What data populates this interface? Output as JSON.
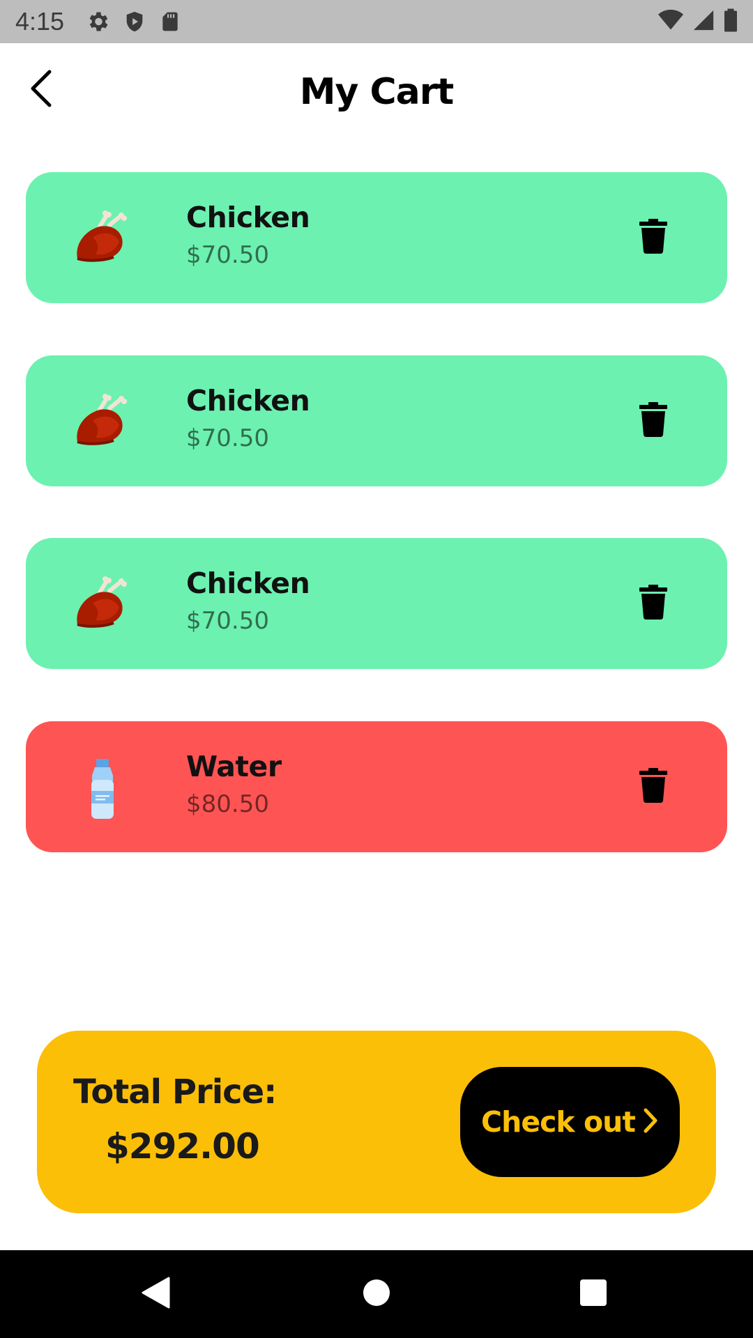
{
  "status_bar": {
    "time": "4:15",
    "icons": [
      "gear-icon",
      "shield-icon",
      "sd-card-icon",
      "wifi-icon",
      "cell-signal-icon",
      "battery-icon"
    ]
  },
  "header": {
    "title": "My Cart",
    "back_icon": "chevron-left-icon"
  },
  "cart": {
    "items": [
      {
        "name": "Chicken",
        "price": "$70.50",
        "icon": "roast-chicken-icon",
        "color": "#6cf1b0"
      },
      {
        "name": "Chicken",
        "price": "$70.50",
        "icon": "roast-chicken-icon",
        "color": "#6cf1b0"
      },
      {
        "name": "Chicken",
        "price": "$70.50",
        "icon": "roast-chicken-icon",
        "color": "#6cf1b0"
      },
      {
        "name": "Water",
        "price": "$80.50",
        "icon": "water-bottle-icon",
        "color": "#ff5454"
      }
    ],
    "delete_icon": "trash-icon"
  },
  "summary": {
    "total_label": "Total Price:",
    "total_value": "$292.00",
    "checkout_label": "Check out",
    "panel_color": "#fcbf07"
  },
  "nav_bar": {
    "buttons": [
      "back-triangle-icon",
      "home-circle-icon",
      "recents-square-icon"
    ]
  }
}
